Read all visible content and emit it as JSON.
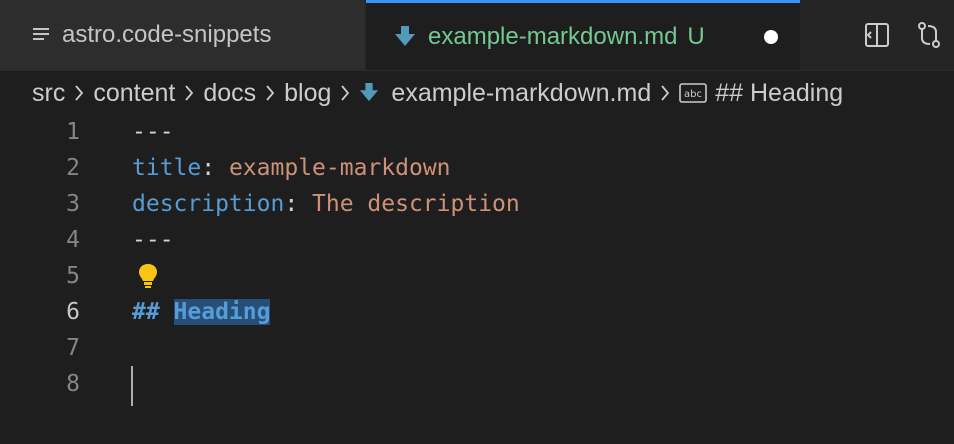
{
  "tabs": {
    "inactive_label": "astro.code-snippets",
    "active_label": "example-markdown.md",
    "active_status": "U"
  },
  "breadcrumb": {
    "items": [
      "src",
      "content",
      "docs",
      "blog",
      "example-markdown.md",
      "## Heading"
    ]
  },
  "editor": {
    "lines": [
      {
        "number": "1",
        "parts": [
          {
            "text": "---",
            "kind": "punct"
          }
        ]
      },
      {
        "number": "2",
        "parts": [
          {
            "text": "title",
            "kind": "key"
          },
          {
            "text": ": ",
            "kind": "punct"
          },
          {
            "text": "example-markdown",
            "kind": "str"
          }
        ]
      },
      {
        "number": "3",
        "parts": [
          {
            "text": "description",
            "kind": "key"
          },
          {
            "text": ": ",
            "kind": "punct"
          },
          {
            "text": "The description",
            "kind": "str"
          }
        ]
      },
      {
        "number": "4",
        "parts": [
          {
            "text": "---",
            "kind": "punct"
          }
        ]
      },
      {
        "number": "5",
        "parts": []
      },
      {
        "number": "6",
        "parts": [
          {
            "text": "## ",
            "kind": "head"
          },
          {
            "text": "Heading",
            "kind": "head-sel"
          }
        ]
      },
      {
        "number": "7",
        "parts": []
      },
      {
        "number": "8",
        "parts": []
      }
    ],
    "current_line": "6"
  },
  "colors": {
    "accent": "#3794ff",
    "untracked": "#73c991",
    "keyword": "#569cd6",
    "string": "#ce9178",
    "selection": "#264f78",
    "lightbulb": "#f9c513"
  },
  "icons": {
    "snippets_file": "list-icon",
    "markdown_file": "markdown-arrow-icon",
    "heading_symbol": "abc-symbol-icon",
    "split_editor": "split-editor-icon",
    "source_control": "git-compare-icon",
    "lightbulb": "lightbulb-icon"
  }
}
